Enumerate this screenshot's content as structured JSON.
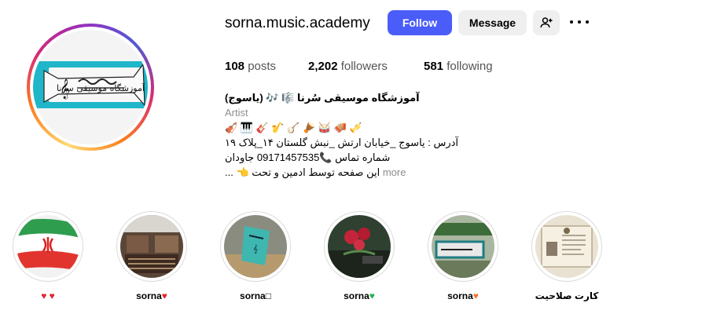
{
  "profile": {
    "username": "sorna.music.academy",
    "follow_label": "Follow",
    "message_label": "Message",
    "posts_count": "108",
    "posts_label": "posts",
    "followers_count": "2,202",
    "followers_label": "followers",
    "following_count": "581",
    "following_label": "following",
    "avatar_text": "آموزشگاه موسیقی سرنا"
  },
  "bio": {
    "name": "آموزشگاه موسیقی سُرنا 🎼 🎶 (یاسوج)",
    "category": "Artist",
    "emoji_line": "🎻 🎹 🎸 🎷 🪕 🪘 🥁 🪗 🎺",
    "address": "آدرس : یاسوج _خیابان ارتش _نبش گلستان ۱۴_پلاک ۱۹",
    "phone": "شماره تماس 📞09171457535 جاودان",
    "note": "این صفحه توسط ادمین و تحت 👈 ...",
    "more_label": "more"
  },
  "highlights": [
    {
      "label": "♥ ♥",
      "heart": ""
    },
    {
      "label": "sorna",
      "heart": "♥"
    },
    {
      "label": "sorna□",
      "heart": ""
    },
    {
      "label": "sorna",
      "heart": "♥"
    },
    {
      "label": "sorna",
      "heart": "♥"
    },
    {
      "label": "کارت صلاحیت",
      "heart": ""
    }
  ],
  "colors": {
    "follow_button": "#4a5df9",
    "secondary_button": "#efefef",
    "heart_red": "#e0242a",
    "heart_green": "#1fb24a",
    "heart_orange": "#f2742c"
  }
}
